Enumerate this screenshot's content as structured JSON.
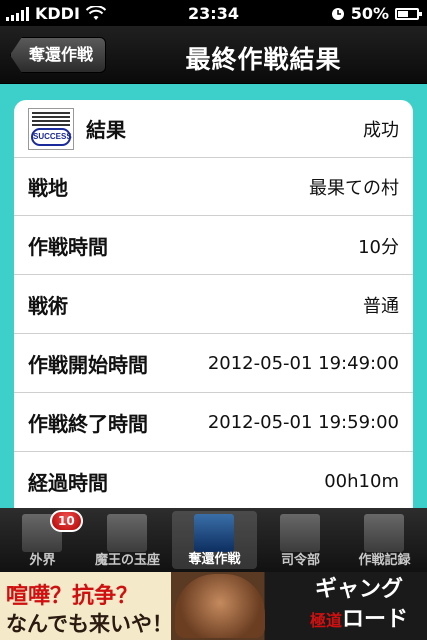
{
  "status_bar": {
    "carrier": "KDDI",
    "time": "23:34",
    "battery": "50%",
    "battery_level": 0.5
  },
  "nav": {
    "back_label": "奪還作戦",
    "title": "最終作戦結果"
  },
  "result_rows": [
    {
      "label": "結果",
      "value": "成功",
      "icon": "success-stamp-icon",
      "icon_text": "SUCCESS"
    },
    {
      "label": "戦地",
      "value": "最果ての村"
    },
    {
      "label": "作戦時間",
      "value": "10分"
    },
    {
      "label": "戦術",
      "value": "普通"
    },
    {
      "label": "作戦開始時間",
      "value": "2012-05-01 19:49:00"
    },
    {
      "label": "作戦終了時間",
      "value": "2012-05-01 19:59:00"
    },
    {
      "label": "経過時間",
      "value": "00h10m"
    }
  ],
  "tabs": [
    {
      "label": "外界",
      "badge": "10",
      "icon": "gate-icon"
    },
    {
      "label": "魔王の玉座",
      "icon": "throne-icon"
    },
    {
      "label": "奪還作戦",
      "icon": "battle-map-icon",
      "selected": true
    },
    {
      "label": "司令部",
      "icon": "headquarters-icon"
    },
    {
      "label": "作戦記録",
      "icon": "record-icon"
    }
  ],
  "ad": {
    "line1": "喧嘩？抗争？",
    "line2": "なんでも来いや！",
    "brand_line1": "ギャング",
    "brand_line2": "ロード",
    "brand_kanji": "極道"
  },
  "colors": {
    "accent": "#3dcfc9",
    "nav_bg": "#111111",
    "badge_red": "#d01010"
  }
}
